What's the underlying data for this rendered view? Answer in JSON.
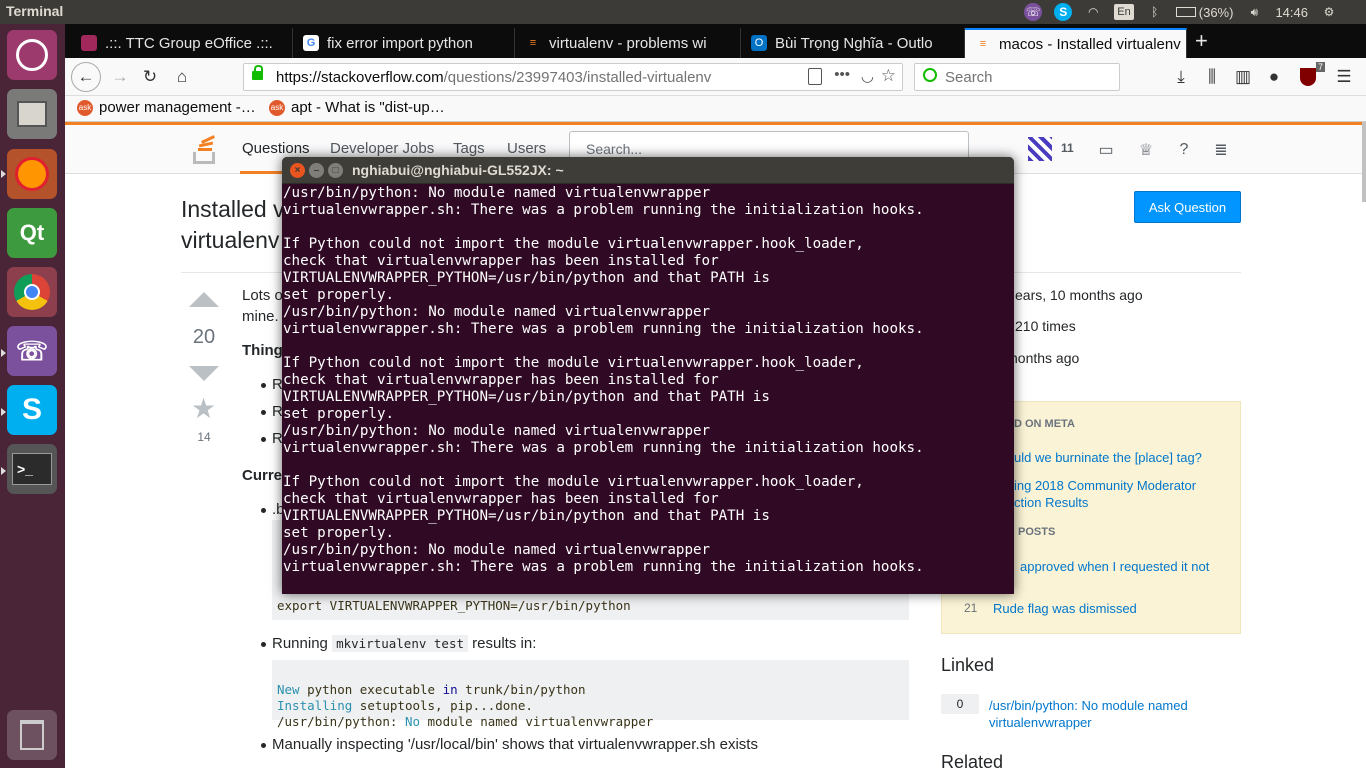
{
  "top_panel": {
    "app_title": "Terminal",
    "keyboard": "En",
    "battery": "(36%)",
    "time": "14:46"
  },
  "launcher": {
    "items": [
      "ubuntu-dash",
      "files",
      "firefox",
      "qt-creator",
      "chrome",
      "viber",
      "skype",
      "terminal",
      "trash"
    ],
    "qt_label": "Qt",
    "skype_label": "S"
  },
  "browser": {
    "tabs": [
      {
        "label": ".::. TTC Group eOffice .::."
      },
      {
        "label": "fix error import python"
      },
      {
        "label": "virtualenv - problems wi"
      },
      {
        "label": "Bùi Trọng Nghĩa - Outlo"
      },
      {
        "label": "macos - Installed virtualenv"
      }
    ],
    "url_host": "https://stackoverflow.com",
    "url_path": "/questions/23997403/installed-virtualenv",
    "search_placeholder": "Search",
    "ublock_count": "7",
    "bookmarks": [
      {
        "label": "power management -…"
      },
      {
        "label": "apt - What is \"dist-up…"
      }
    ],
    "bm_icon_label": "ask"
  },
  "so": {
    "nav": {
      "questions": "Questions",
      "jobs": "Developer Jobs",
      "tags": "Tags",
      "users": "Users"
    },
    "search_placeholder": "Search...",
    "reputation": "11",
    "title_line1": "Installed v",
    "title_line2": "virtualenv",
    "ask_button": "Ask Question",
    "votes": "20",
    "favorites": "14",
    "post": {
      "intro1": "Lots o",
      "intro2": "mine.",
      "things_head": "Thing",
      "bullet_r": "R",
      "current_head": "Curre",
      "bashrc_frag": ".b",
      "export_line": "export VIRTUALENVWRAPPER_PYTHON=/usr/bin/python",
      "running_pre": "Running",
      "running_code": "mkvirtualenv test",
      "running_post": "results in:",
      "code2_line1_kw": "New",
      "code2_line1_mid": " python executable ",
      "code2_line1_kw2": "in",
      "code2_line1_rest": " trunk/bin/python",
      "code2_line2_kw": "Installing",
      "code2_line2_rest": " setuptools, pip...done.",
      "code2_line3_pre": "/usr/bin/python: ",
      "code2_line3_kw": "No",
      "code2_line3_rest": " module named virtualenvwrapper",
      "manual_line": "Manually inspecting '/usr/local/bin' shows that virtualenvwrapper.sh exists"
    },
    "meta": {
      "asked": "ears, 10 months ago",
      "viewed": "210 times",
      "active": "nonths ago",
      "featured_head": "D ON META",
      "featured_1": "uld we burninate the [place] tag?",
      "featured_2a": "ing 2018 Community Moderator",
      "featured_2b": "ction Results",
      "hot_head": "POSTS",
      "hot_1": "approved when I requested it not",
      "hot_2_num": "21",
      "hot_2": "Rude flag was dismissed"
    },
    "linked_head": "Linked",
    "linked_count": "0",
    "linked_link": "/usr/bin/python: No module named virtualenvwrapper",
    "related_head": "Related"
  },
  "terminal": {
    "title": "nghiabui@nghiabui-GL552JX: ~",
    "lines": [
      "/usr/bin/python: No module named virtualenvwrapper",
      "virtualenvwrapper.sh: There was a problem running the initialization hooks.",
      "",
      "If Python could not import the module virtualenvwrapper.hook_loader,",
      "check that virtualenvwrapper has been installed for",
      "VIRTUALENVWRAPPER_PYTHON=/usr/bin/python and that PATH is",
      "set properly.",
      "/usr/bin/python: No module named virtualenvwrapper",
      "virtualenvwrapper.sh: There was a problem running the initialization hooks.",
      "",
      "If Python could not import the module virtualenvwrapper.hook_loader,",
      "check that virtualenvwrapper has been installed for",
      "VIRTUALENVWRAPPER_PYTHON=/usr/bin/python and that PATH is",
      "set properly.",
      "/usr/bin/python: No module named virtualenvwrapper",
      "virtualenvwrapper.sh: There was a problem running the initialization hooks.",
      "",
      "If Python could not import the module virtualenvwrapper.hook_loader,",
      "check that virtualenvwrapper has been installed for",
      "VIRTUALENVWRAPPER_PYTHON=/usr/bin/python and that PATH is",
      "set properly.",
      "/usr/bin/python: No module named virtualenvwrapper",
      "virtualenvwrapper.sh: There was a problem running the initialization hooks."
    ]
  }
}
